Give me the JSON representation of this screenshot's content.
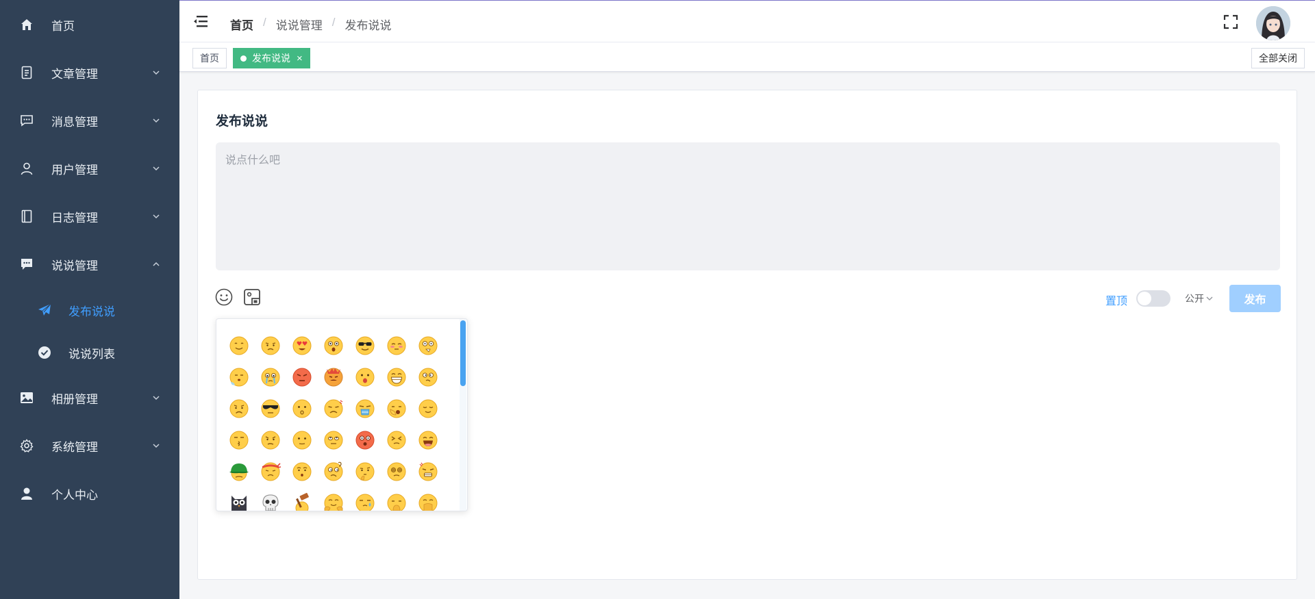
{
  "sidebar": {
    "items": [
      {
        "label": "首页",
        "icon": "home-icon"
      },
      {
        "label": "文章管理",
        "icon": "document-icon"
      },
      {
        "label": "消息管理",
        "icon": "message-icon"
      },
      {
        "label": "用户管理",
        "icon": "user-icon"
      },
      {
        "label": "日志管理",
        "icon": "notebook-icon"
      },
      {
        "label": "说说管理",
        "icon": "chat-icon"
      },
      {
        "label": "相册管理",
        "icon": "picture-icon"
      },
      {
        "label": "系统管理",
        "icon": "gear-icon"
      },
      {
        "label": "个人中心",
        "icon": "person-icon"
      }
    ],
    "sub_items": [
      {
        "label": "发布说说",
        "icon": "send-icon"
      },
      {
        "label": "说说列表",
        "icon": "check-circle-icon"
      }
    ]
  },
  "breadcrumb": [
    "首页",
    "说说管理",
    "发布说说"
  ],
  "tags": {
    "home": "首页",
    "active": "发布说说",
    "close_all": "全部关闭"
  },
  "card": {
    "title": "发布说说",
    "placeholder": "说点什么吧",
    "pin_label": "置顶",
    "visibility": "公开",
    "publish": "发布"
  },
  "colors": {
    "sidebar_bg": "#304156",
    "accent": "#409eff",
    "tag_active": "#42b983",
    "publish_disabled": "#a0cfff"
  }
}
